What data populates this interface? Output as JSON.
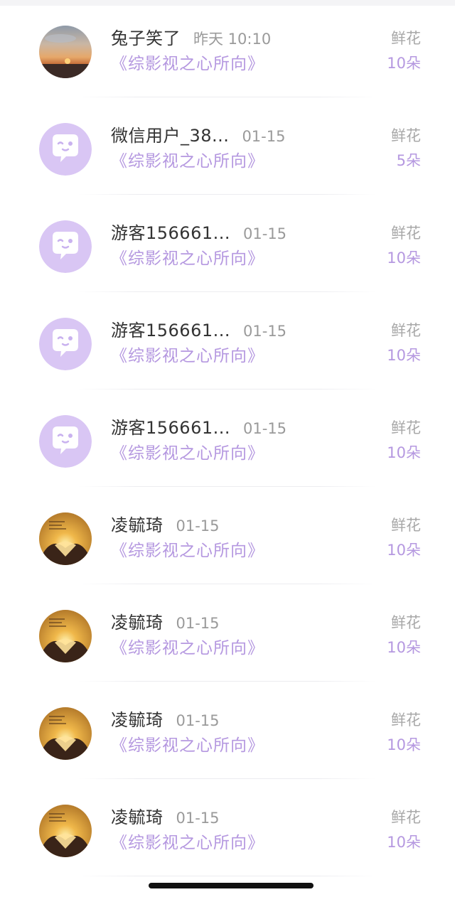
{
  "items": [
    {
      "name": "兔子笑了",
      "time": "昨天 10:10",
      "work": "《综影视之心所向》",
      "gift": "鲜花",
      "count": "10朵",
      "avatar": "sunset-photo-avatar"
    },
    {
      "name": "微信用户_38...",
      "time": "01-15",
      "work": "《综影视之心所向》",
      "gift": "鲜花",
      "count": "5朵",
      "avatar": "default-chat-avatar"
    },
    {
      "name": "游客156661...",
      "time": "01-15",
      "work": "《综影视之心所向》",
      "gift": "鲜花",
      "count": "10朵",
      "avatar": "default-chat-avatar"
    },
    {
      "name": "游客156661...",
      "time": "01-15",
      "work": "《综影视之心所向》",
      "gift": "鲜花",
      "count": "10朵",
      "avatar": "default-chat-avatar"
    },
    {
      "name": "游客156661...",
      "time": "01-15",
      "work": "《综影视之心所向》",
      "gift": "鲜花",
      "count": "10朵",
      "avatar": "default-chat-avatar"
    },
    {
      "name": "凌毓琦",
      "time": "01-15",
      "work": "《综影视之心所向》",
      "gift": "鲜花",
      "count": "10朵",
      "avatar": "heart-hands-photo-avatar"
    },
    {
      "name": "凌毓琦",
      "time": "01-15",
      "work": "《综影视之心所向》",
      "gift": "鲜花",
      "count": "10朵",
      "avatar": "heart-hands-photo-avatar"
    },
    {
      "name": "凌毓琦",
      "time": "01-15",
      "work": "《综影视之心所向》",
      "gift": "鲜花",
      "count": "10朵",
      "avatar": "heart-hands-photo-avatar"
    },
    {
      "name": "凌毓琦",
      "time": "01-15",
      "work": "《综影视之心所向》",
      "gift": "鲜花",
      "count": "10朵",
      "avatar": "heart-hands-photo-avatar"
    }
  ],
  "colors": {
    "accent": "#b598e0",
    "avatar_bg": "#d9c6f4",
    "name": "#333333",
    "muted": "#a8a8a8"
  }
}
